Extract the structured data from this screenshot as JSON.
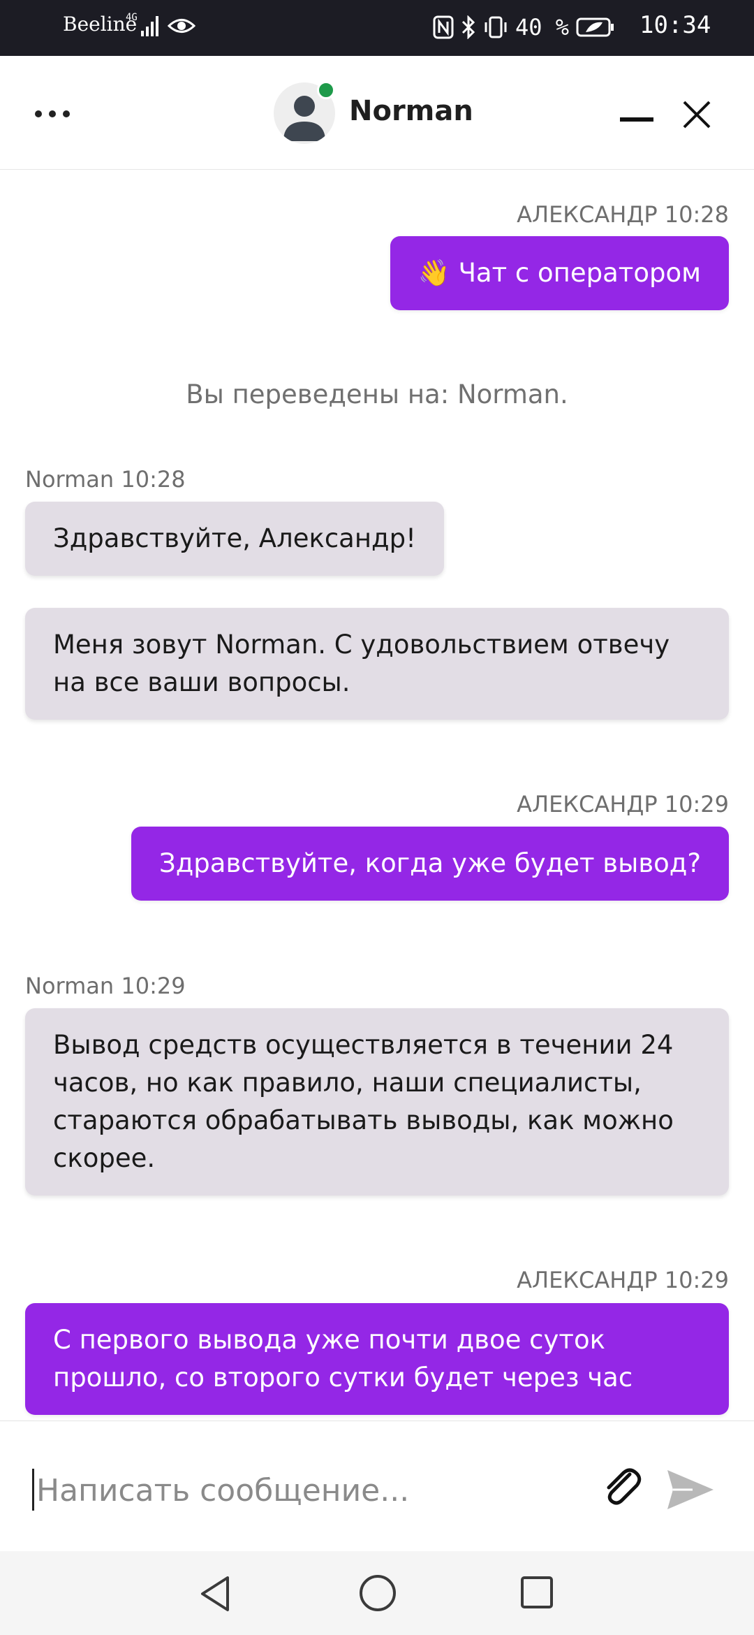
{
  "status_bar": {
    "carrier": "Beeline",
    "network": "4G",
    "battery": "40 %",
    "time": "10:34",
    "icons": [
      "signal-icon",
      "eye-icon",
      "nfc-icon",
      "bluetooth-icon",
      "vibrate-icon",
      "battery-icon"
    ]
  },
  "header": {
    "agent_name": "Norman",
    "status_color": "#1e9a4a",
    "icons": [
      "more-icon",
      "avatar-icon",
      "minimize-icon",
      "close-icon"
    ]
  },
  "messages": [
    {
      "id": "m1",
      "direction": "out",
      "meta": "АЛЕКСАНДР 10:28",
      "text": "👋 Чат с оператором"
    },
    {
      "id": "s1",
      "direction": "system",
      "text": "Вы переведены на: Norman."
    },
    {
      "id": "m2",
      "direction": "in",
      "meta": "Norman 10:28",
      "text": "Здравствуйте, Александр!"
    },
    {
      "id": "m3",
      "direction": "in",
      "lines": [
        "Меня зовут Norman. С удовольствием отвечу",
        "на все ваши вопросы."
      ]
    },
    {
      "id": "m4",
      "direction": "out",
      "meta": "АЛЕКСАНДР 10:29",
      "text": "Здравствуйте, когда уже будет вывод?"
    },
    {
      "id": "m5",
      "direction": "in",
      "meta": "Norman 10:29",
      "lines": [
        "Вывод средств осуществляется в течении 24",
        "часов, но как правило, наши специалисты,",
        "стараются обрабатывать выводы, как можно",
        "скорее."
      ]
    },
    {
      "id": "m6",
      "direction": "out",
      "meta": "АЛЕКСАНДР 10:29",
      "lines": [
        "С первого вывода уже почти двое суток",
        "прошло, со второго сутки будет через час"
      ]
    }
  ],
  "composer": {
    "placeholder": "Написать сообщение...",
    "value": "",
    "icons": [
      "attach-icon",
      "send-icon"
    ]
  },
  "colors": {
    "accent": "#9427e6",
    "incoming_bubble": "#e2dde5",
    "status_bar_bg": "#1c1c24"
  },
  "nav": {
    "icons": [
      "back-icon",
      "home-icon",
      "recents-icon"
    ]
  }
}
